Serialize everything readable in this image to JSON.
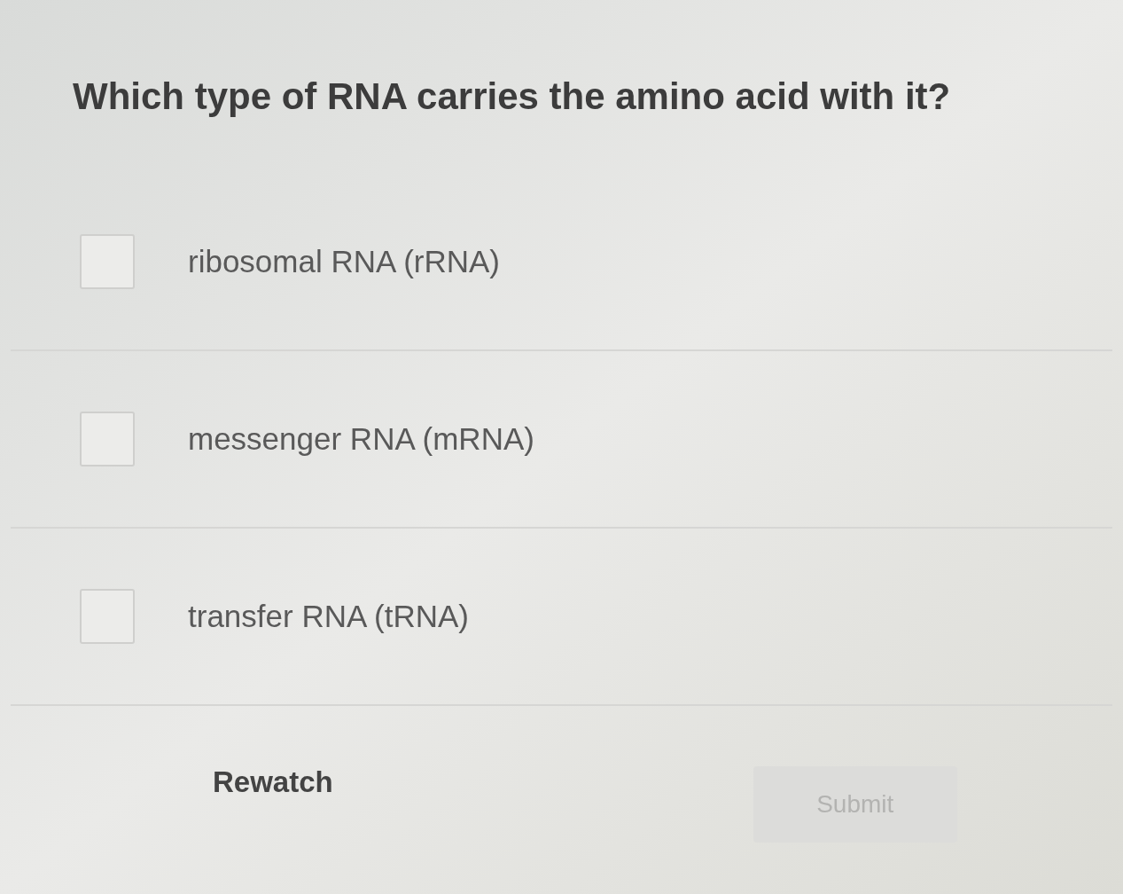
{
  "question": "Which type of RNA carries the amino acid with it?",
  "options": [
    {
      "label": "ribosomal RNA (rRNA)",
      "checked": false
    },
    {
      "label": "messenger RNA (mRNA)",
      "checked": false
    },
    {
      "label": "transfer RNA (tRNA)",
      "checked": false
    }
  ],
  "actions": {
    "rewatch": "Rewatch",
    "submit": {
      "label": "Submit",
      "disabled": true
    }
  }
}
